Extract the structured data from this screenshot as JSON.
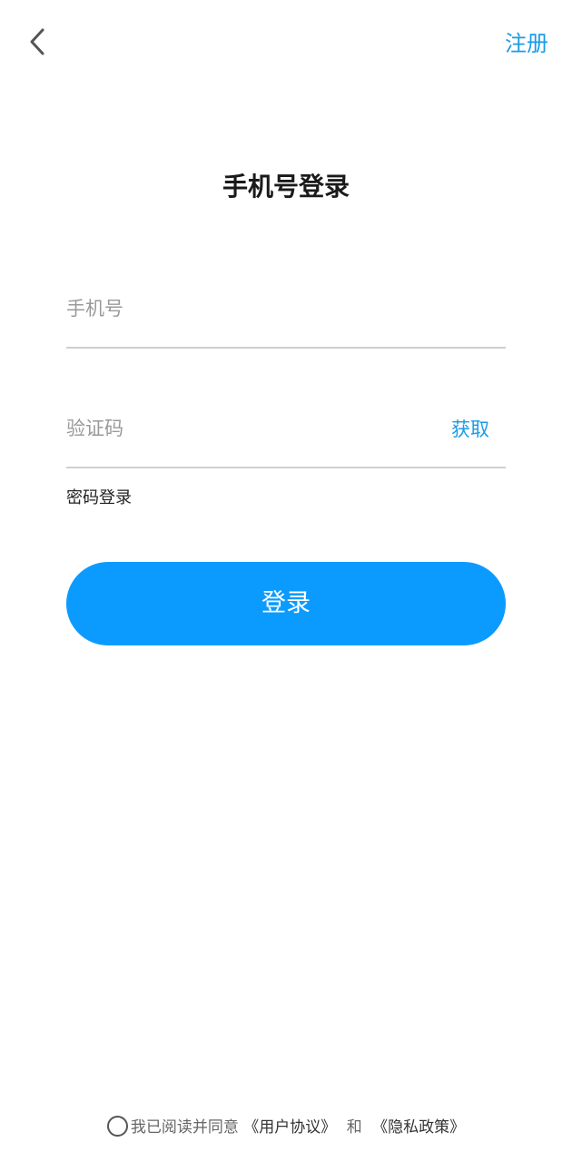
{
  "header": {
    "back_icon": "chevron-left-icon",
    "register_label": "注册",
    "accent_color": "#1a9be6"
  },
  "title": "手机号登录",
  "phone_field": {
    "value": "",
    "placeholder": "手机号"
  },
  "code_field": {
    "value": "",
    "placeholder": "验证码",
    "get_code_label": "获取"
  },
  "password_login_label": "密码登录",
  "login_button": {
    "label": "登录",
    "color": "#0b9bff"
  },
  "agreement": {
    "checked": false,
    "prefix": "我已阅读并同意",
    "user_agreement": "《用户协议》",
    "conjunction": "和",
    "privacy_policy": "《隐私政策》"
  }
}
